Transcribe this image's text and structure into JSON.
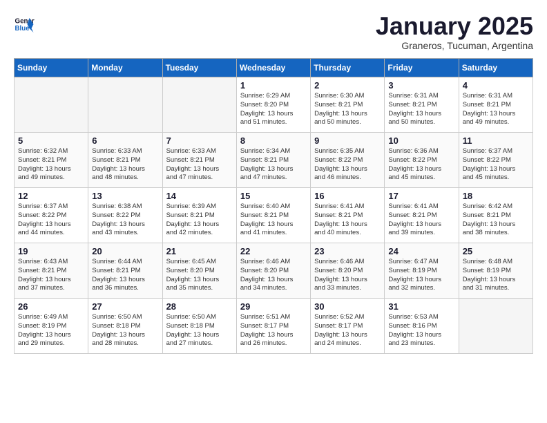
{
  "header": {
    "logo_general": "General",
    "logo_blue": "Blue",
    "month_title": "January 2025",
    "subtitle": "Graneros, Tucuman, Argentina"
  },
  "weekdays": [
    "Sunday",
    "Monday",
    "Tuesday",
    "Wednesday",
    "Thursday",
    "Friday",
    "Saturday"
  ],
  "weeks": [
    [
      {
        "day": "",
        "info": "",
        "empty": true
      },
      {
        "day": "",
        "info": "",
        "empty": true
      },
      {
        "day": "",
        "info": "",
        "empty": true
      },
      {
        "day": "1",
        "info": "Sunrise: 6:29 AM\nSunset: 8:20 PM\nDaylight: 13 hours\nand 51 minutes.",
        "empty": false
      },
      {
        "day": "2",
        "info": "Sunrise: 6:30 AM\nSunset: 8:21 PM\nDaylight: 13 hours\nand 50 minutes.",
        "empty": false
      },
      {
        "day": "3",
        "info": "Sunrise: 6:31 AM\nSunset: 8:21 PM\nDaylight: 13 hours\nand 50 minutes.",
        "empty": false
      },
      {
        "day": "4",
        "info": "Sunrise: 6:31 AM\nSunset: 8:21 PM\nDaylight: 13 hours\nand 49 minutes.",
        "empty": false
      }
    ],
    [
      {
        "day": "5",
        "info": "Sunrise: 6:32 AM\nSunset: 8:21 PM\nDaylight: 13 hours\nand 49 minutes.",
        "empty": false
      },
      {
        "day": "6",
        "info": "Sunrise: 6:33 AM\nSunset: 8:21 PM\nDaylight: 13 hours\nand 48 minutes.",
        "empty": false
      },
      {
        "day": "7",
        "info": "Sunrise: 6:33 AM\nSunset: 8:21 PM\nDaylight: 13 hours\nand 47 minutes.",
        "empty": false
      },
      {
        "day": "8",
        "info": "Sunrise: 6:34 AM\nSunset: 8:21 PM\nDaylight: 13 hours\nand 47 minutes.",
        "empty": false
      },
      {
        "day": "9",
        "info": "Sunrise: 6:35 AM\nSunset: 8:22 PM\nDaylight: 13 hours\nand 46 minutes.",
        "empty": false
      },
      {
        "day": "10",
        "info": "Sunrise: 6:36 AM\nSunset: 8:22 PM\nDaylight: 13 hours\nand 45 minutes.",
        "empty": false
      },
      {
        "day": "11",
        "info": "Sunrise: 6:37 AM\nSunset: 8:22 PM\nDaylight: 13 hours\nand 45 minutes.",
        "empty": false
      }
    ],
    [
      {
        "day": "12",
        "info": "Sunrise: 6:37 AM\nSunset: 8:22 PM\nDaylight: 13 hours\nand 44 minutes.",
        "empty": false
      },
      {
        "day": "13",
        "info": "Sunrise: 6:38 AM\nSunset: 8:22 PM\nDaylight: 13 hours\nand 43 minutes.",
        "empty": false
      },
      {
        "day": "14",
        "info": "Sunrise: 6:39 AM\nSunset: 8:21 PM\nDaylight: 13 hours\nand 42 minutes.",
        "empty": false
      },
      {
        "day": "15",
        "info": "Sunrise: 6:40 AM\nSunset: 8:21 PM\nDaylight: 13 hours\nand 41 minutes.",
        "empty": false
      },
      {
        "day": "16",
        "info": "Sunrise: 6:41 AM\nSunset: 8:21 PM\nDaylight: 13 hours\nand 40 minutes.",
        "empty": false
      },
      {
        "day": "17",
        "info": "Sunrise: 6:41 AM\nSunset: 8:21 PM\nDaylight: 13 hours\nand 39 minutes.",
        "empty": false
      },
      {
        "day": "18",
        "info": "Sunrise: 6:42 AM\nSunset: 8:21 PM\nDaylight: 13 hours\nand 38 minutes.",
        "empty": false
      }
    ],
    [
      {
        "day": "19",
        "info": "Sunrise: 6:43 AM\nSunset: 8:21 PM\nDaylight: 13 hours\nand 37 minutes.",
        "empty": false
      },
      {
        "day": "20",
        "info": "Sunrise: 6:44 AM\nSunset: 8:21 PM\nDaylight: 13 hours\nand 36 minutes.",
        "empty": false
      },
      {
        "day": "21",
        "info": "Sunrise: 6:45 AM\nSunset: 8:20 PM\nDaylight: 13 hours\nand 35 minutes.",
        "empty": false
      },
      {
        "day": "22",
        "info": "Sunrise: 6:46 AM\nSunset: 8:20 PM\nDaylight: 13 hours\nand 34 minutes.",
        "empty": false
      },
      {
        "day": "23",
        "info": "Sunrise: 6:46 AM\nSunset: 8:20 PM\nDaylight: 13 hours\nand 33 minutes.",
        "empty": false
      },
      {
        "day": "24",
        "info": "Sunrise: 6:47 AM\nSunset: 8:19 PM\nDaylight: 13 hours\nand 32 minutes.",
        "empty": false
      },
      {
        "day": "25",
        "info": "Sunrise: 6:48 AM\nSunset: 8:19 PM\nDaylight: 13 hours\nand 31 minutes.",
        "empty": false
      }
    ],
    [
      {
        "day": "26",
        "info": "Sunrise: 6:49 AM\nSunset: 8:19 PM\nDaylight: 13 hours\nand 29 minutes.",
        "empty": false
      },
      {
        "day": "27",
        "info": "Sunrise: 6:50 AM\nSunset: 8:18 PM\nDaylight: 13 hours\nand 28 minutes.",
        "empty": false
      },
      {
        "day": "28",
        "info": "Sunrise: 6:50 AM\nSunset: 8:18 PM\nDaylight: 13 hours\nand 27 minutes.",
        "empty": false
      },
      {
        "day": "29",
        "info": "Sunrise: 6:51 AM\nSunset: 8:17 PM\nDaylight: 13 hours\nand 26 minutes.",
        "empty": false
      },
      {
        "day": "30",
        "info": "Sunrise: 6:52 AM\nSunset: 8:17 PM\nDaylight: 13 hours\nand 24 minutes.",
        "empty": false
      },
      {
        "day": "31",
        "info": "Sunrise: 6:53 AM\nSunset: 8:16 PM\nDaylight: 13 hours\nand 23 minutes.",
        "empty": false
      },
      {
        "day": "",
        "info": "",
        "empty": true
      }
    ]
  ]
}
